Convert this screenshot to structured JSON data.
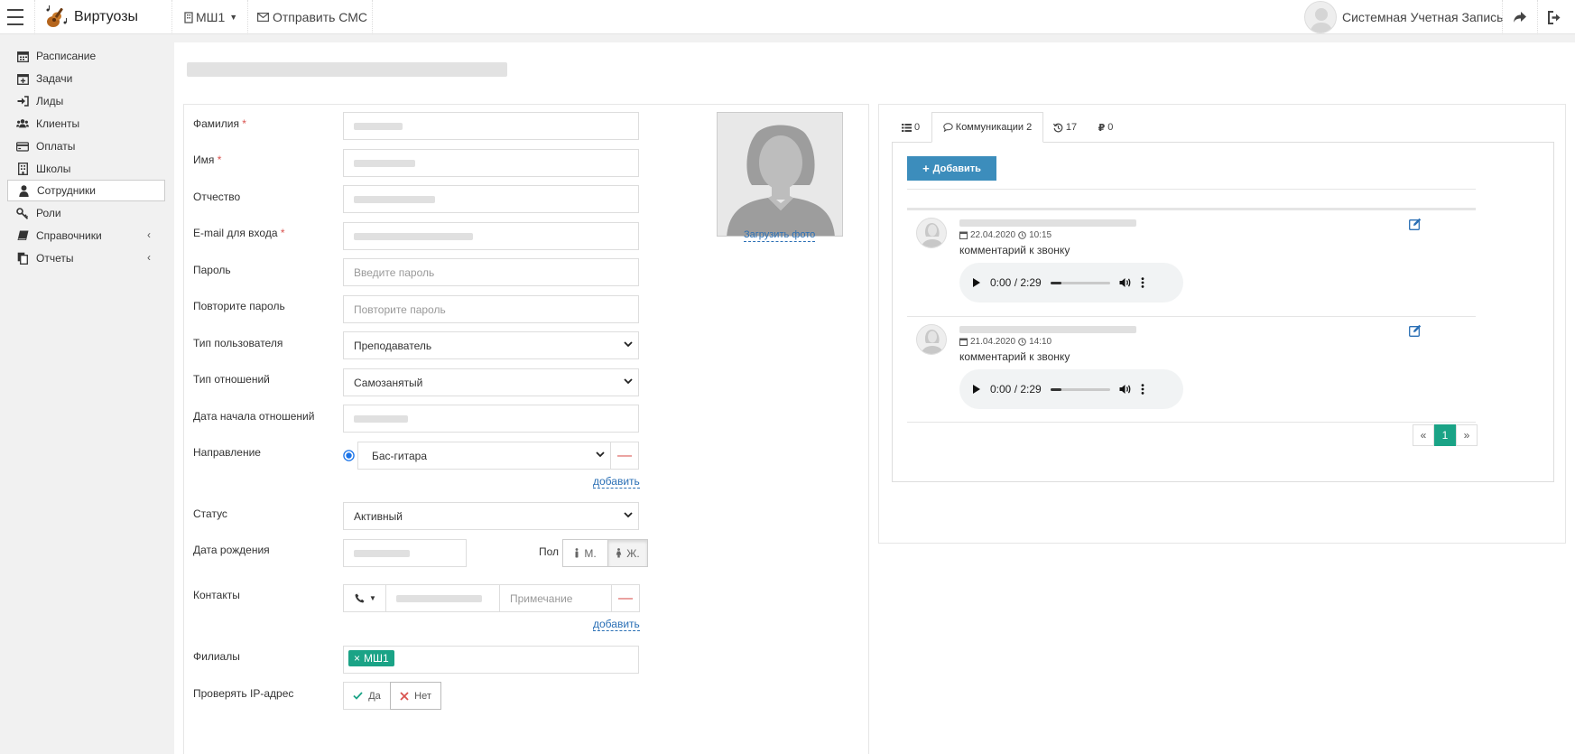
{
  "app": {
    "brand": "Виртуозы",
    "school": "МШ1",
    "send_sms": "Отправить СМС",
    "user_name": "Системная Учетная Запись"
  },
  "sidebar": {
    "items": [
      {
        "label": "Расписание",
        "icon": "calendar-icon"
      },
      {
        "label": "Задачи",
        "icon": "calendar-plus-icon"
      },
      {
        "label": "Лиды",
        "icon": "sign-in-icon"
      },
      {
        "label": "Клиенты",
        "icon": "users-icon"
      },
      {
        "label": "Оплаты",
        "icon": "credit-card-icon"
      },
      {
        "label": "Школы",
        "icon": "building-icon"
      },
      {
        "label": "Сотрудники",
        "icon": "user-icon"
      },
      {
        "label": "Роли",
        "icon": "key-icon"
      },
      {
        "label": "Справочники",
        "icon": "book-icon"
      },
      {
        "label": "Отчеты",
        "icon": "copy-icon"
      }
    ],
    "active": "Сотрудники"
  },
  "form": {
    "last_name_label": "Фамилия",
    "first_name_label": "Имя",
    "middle_name_label": "Отчество",
    "email_label": "E-mail для входа",
    "required_mark": "*",
    "password_label": "Пароль",
    "password_placeholder": "Введите пароль",
    "password_repeat_label": "Повторите пароль",
    "password_repeat_placeholder": "Повторите пароль",
    "user_type_label": "Тип пользователя",
    "user_type_value": "Преподаватель",
    "relation_type_label": "Тип отношений",
    "relation_type_value": "Самозанятый",
    "relation_start_label": "Дата начала отношений",
    "direction_label": "Направление",
    "direction_value": "Бас-гитара",
    "add_link": "добавить",
    "status_label": "Статус",
    "status_value": "Активный",
    "birth_label": "Дата рождения",
    "gender_label": "Пол",
    "gender_male": "М.",
    "gender_female": "Ж.",
    "gender_selected": "Ж.",
    "contacts_label": "Контакты",
    "contact_note_placeholder": "Примечание",
    "branches_label": "Филиалы",
    "branch_tag": "МШ1",
    "check_ip_label": "Проверять IP-адрес",
    "ip_yes": "Да",
    "ip_no": "Нет",
    "upload_photo": "Загрузить фото"
  },
  "comm": {
    "tabs": [
      {
        "label": "0",
        "icon": "list-icon"
      },
      {
        "label": "Коммуникации 2",
        "icon": "comment-icon"
      },
      {
        "label": "17",
        "icon": "history-icon"
      },
      {
        "label": "0",
        "icon": "ruble-icon"
      }
    ],
    "add_button": "Добавить",
    "items": [
      {
        "date": "22.04.2020",
        "time": "10:15",
        "text": "комментарий к звонку",
        "audio_time": "0:00 / 2:29"
      },
      {
        "date": "21.04.2020",
        "time": "14:10",
        "text": "комментарий к звонку",
        "audio_time": "0:00 / 2:29"
      }
    ],
    "pager": {
      "prev": "«",
      "current": "1",
      "next": "»"
    }
  },
  "colors": {
    "primary": "#3c8dbc",
    "accent": "#1aa386",
    "danger": "#d9534f",
    "link": "#2a6fb5"
  }
}
